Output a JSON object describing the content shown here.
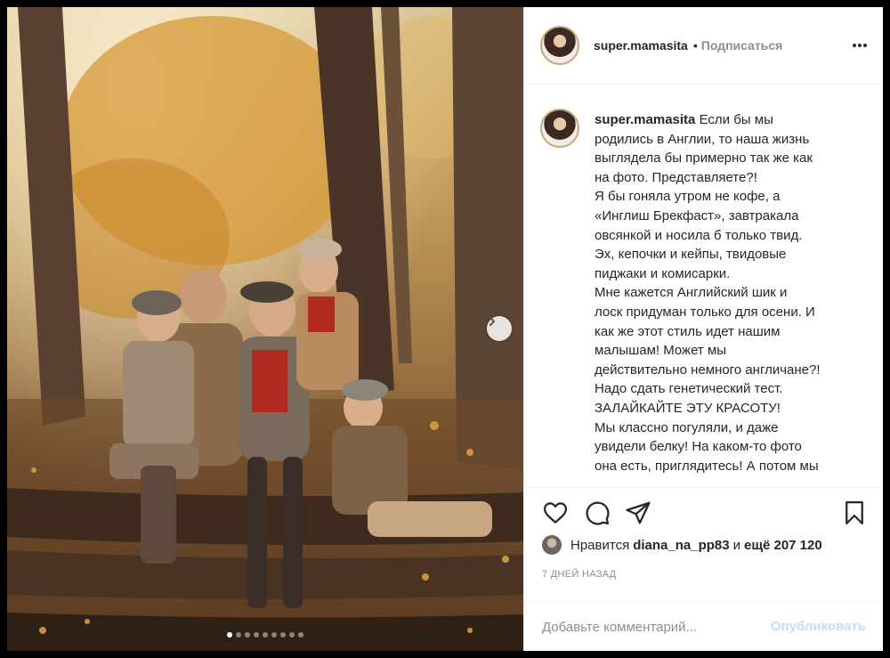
{
  "post": {
    "username": "super.mamasita",
    "separator": "•",
    "follow_label": "Подписаться",
    "more_icon": "more-horizontal-icon",
    "caption_lines": [
      "Если бы мы",
      "родились в Англии, то наша жизнь",
      "выглядела бы примерно так же как",
      "на фото. Представляете?!",
      "Я бы гоняла утром не кофе, а",
      "«Инглиш Брекфаст», завтракала",
      "овсянкой и носила б только твид.",
      "Эх, кепочки и кейпы, твидовые",
      "пиджаки и комисарки.",
      "Мне кажется Английский шик и",
      "лоск придуман только для осени. И",
      "как же этот стиль идет нашим",
      "малышам! Может мы",
      "действительно немного англичане?!",
      "Надо сдать генетический тест.",
      "ЗАЛАЙКАЙТЕ ЭТУ КРАСОТУ!",
      "Мы классно погуляли, и даже",
      "увидели белку! На каком-то фото",
      "она есть, приглядитесь! А потом мы"
    ]
  },
  "carousel": {
    "slide_count": 9,
    "active_index": 0,
    "next_icon": "chevron-right-icon"
  },
  "actions": {
    "like_icon": "heart-icon",
    "comment_icon": "comment-icon",
    "share_icon": "paper-plane-icon",
    "save_icon": "bookmark-icon"
  },
  "likes": {
    "prefix": "Нравится",
    "user": "diana_na_pp83",
    "middle": "и",
    "rest": "ещё 207 120"
  },
  "timestamp": "7 ДНЕЙ НАЗАД",
  "comment": {
    "placeholder": "Добавьте комментарий...",
    "publish_label": "Опубликовать"
  },
  "colors": {
    "text": "#262626",
    "muted": "#8e8e8e",
    "publish_disabled": "#c2ddf6",
    "border": "#efefef"
  }
}
